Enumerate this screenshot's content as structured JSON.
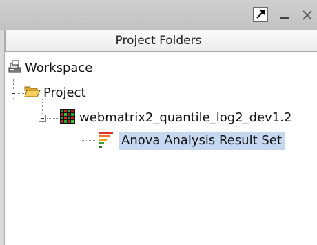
{
  "panel": {
    "title": "Project Folders"
  },
  "tree": {
    "workspace": {
      "label": "Workspace",
      "icon": "workspace-icon"
    },
    "project": {
      "label": "Project",
      "icon": "folder-open-icon",
      "expanded": true
    },
    "dataset": {
      "label": "webmatrix2_quantile_log2_dev1.2",
      "icon": "heatmap-matrix-icon",
      "expanded": true
    },
    "result": {
      "label": "Anova Analysis Result Set",
      "icon": "anova-result-icon",
      "selected": true
    }
  },
  "colors": {
    "selection": "#c6d8f0",
    "titlebar": "#c8c8c8",
    "folder": "#f2c24b"
  }
}
